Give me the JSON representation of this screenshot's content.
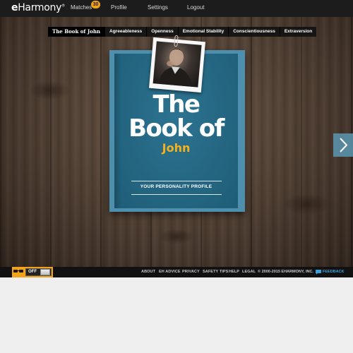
{
  "nav": {
    "logo_prefix": "e",
    "logo_rest": "Harmony",
    "logo_mark": "®",
    "matches_label": "Matches",
    "matches_badge": "30",
    "profile_label": "Profile",
    "settings_label": "Settings",
    "logout_label": "Logout"
  },
  "tabs": [
    "The Book of John",
    "Agreeableness",
    "Openness",
    "Emotional Stability",
    "Conscientiousness",
    "Extraversion"
  ],
  "book": {
    "title_line1": "The",
    "title_line2": "Book of",
    "name": "John",
    "subtitle": "YOUR PERSONALITY PROFILE",
    "cover_color": "#256681",
    "name_color": "#f5b21b"
  },
  "next_icon": "chevron-right-icon",
  "footer": {
    "toggle_label": "OFF",
    "toggle_icon": "glasses-icon",
    "links": [
      "ABOUT",
      "EH ADVICE",
      "PRIVACY",
      "SAFETY TIPS",
      "HELP",
      "LEGAL"
    ],
    "copyright": "© 2000-2015 EHARMONY, INC.",
    "feedback_label": "FEEDBACK",
    "feedback_icon": "chat-bubble-icon"
  },
  "colors": {
    "accent": "#f2a21b",
    "link_blue": "#3aa0d8"
  }
}
